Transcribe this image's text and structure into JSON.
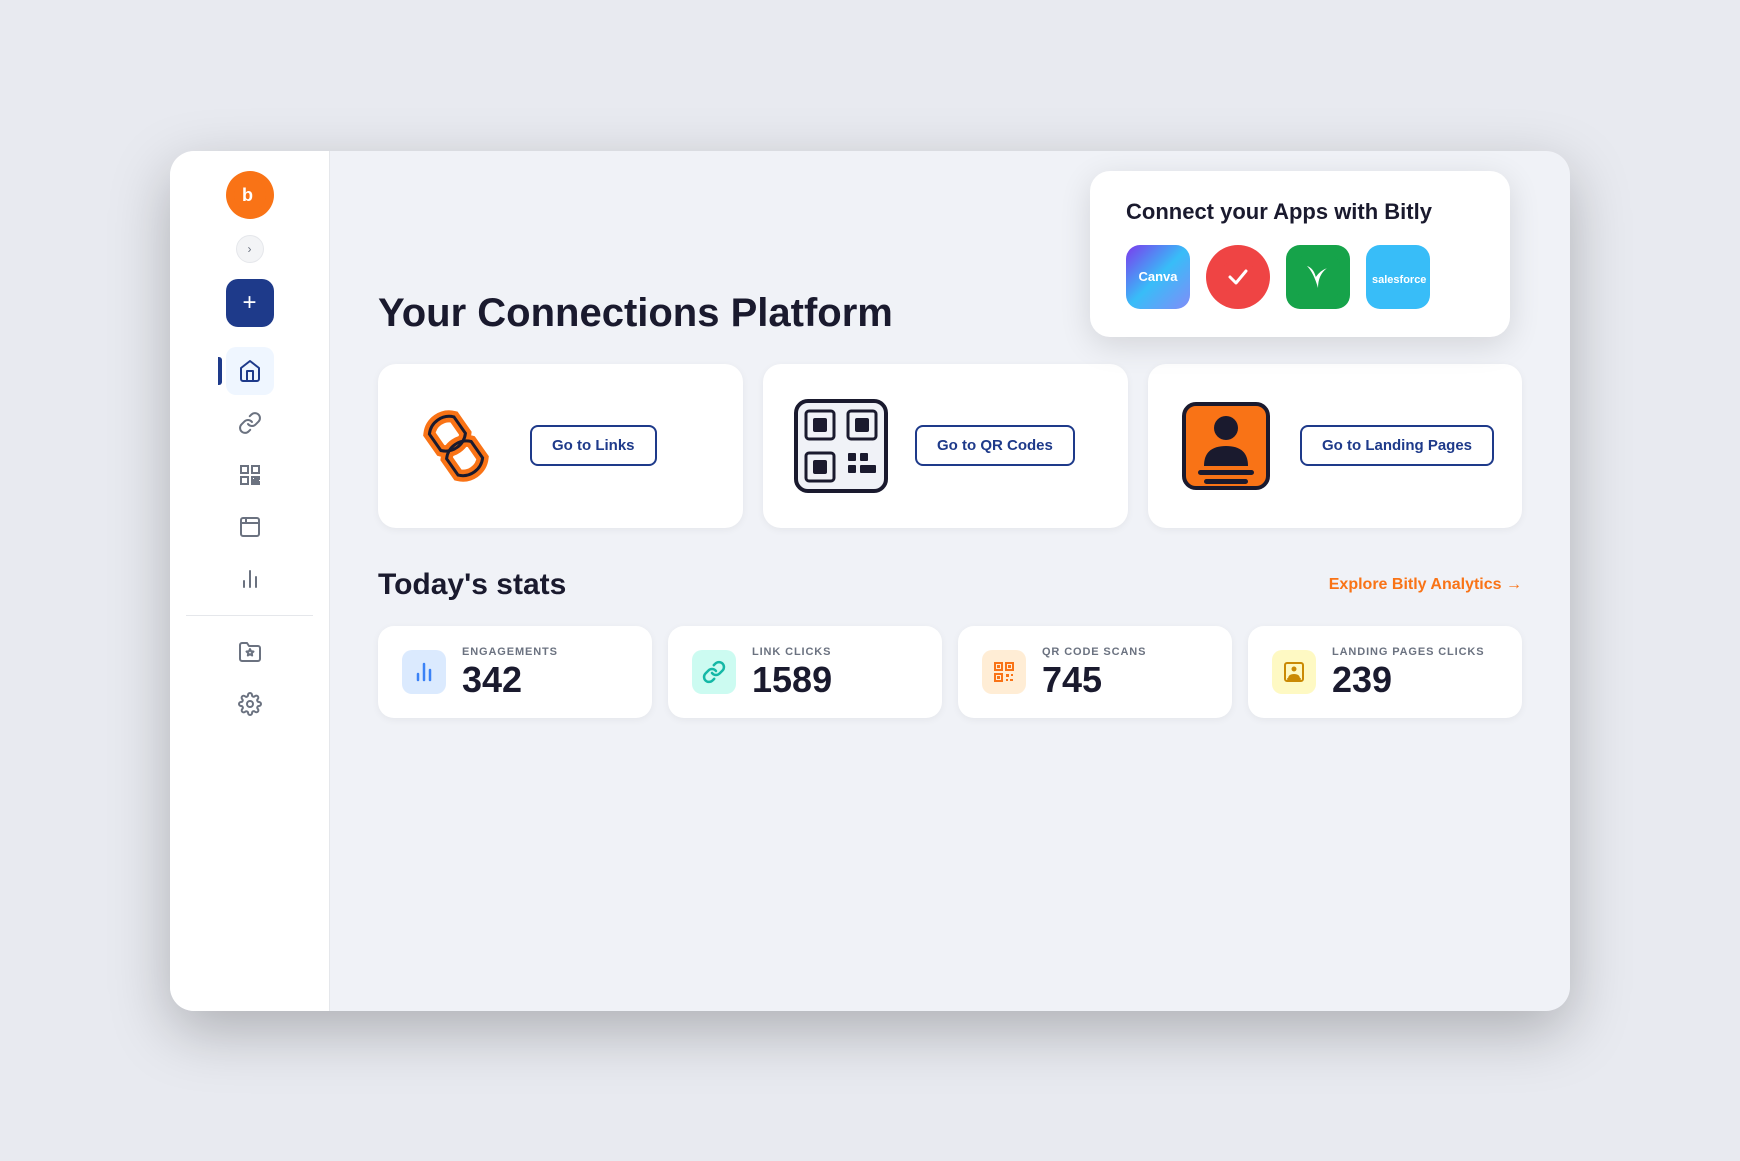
{
  "sidebar": {
    "logo_alt": "Bitly logo",
    "create_label": "+",
    "expand_label": "›",
    "nav_items": [
      {
        "id": "home",
        "label": "Home",
        "active": true
      },
      {
        "id": "links",
        "label": "Links",
        "active": false
      },
      {
        "id": "qr-codes",
        "label": "QR Codes",
        "active": false
      },
      {
        "id": "landing-pages",
        "label": "Landing Pages",
        "active": false
      },
      {
        "id": "analytics",
        "label": "Analytics",
        "active": false
      },
      {
        "id": "starred",
        "label": "Starred",
        "active": false
      },
      {
        "id": "settings",
        "label": "Settings",
        "active": false
      }
    ]
  },
  "popup": {
    "title": "Connect your Apps with Bitly",
    "apps": [
      {
        "id": "canva",
        "label": "Canva"
      },
      {
        "id": "ticktick",
        "label": "TickTick"
      },
      {
        "id": "sprout",
        "label": "Sprout"
      },
      {
        "id": "salesforce",
        "label": "salesforce"
      }
    ]
  },
  "main": {
    "page_title": "Your Connections Platform",
    "nav_cards": [
      {
        "id": "links",
        "button_label": "Go to Links"
      },
      {
        "id": "qr-codes",
        "button_label": "Go to QR Codes"
      },
      {
        "id": "landing-pages",
        "button_label": "Go to Landing Pages"
      }
    ],
    "stats": {
      "title": "Today's stats",
      "explore_link": "Explore Bitly Analytics →",
      "items": [
        {
          "id": "engagements",
          "label": "ENGAGEMENTS",
          "value": "342",
          "icon_type": "blue"
        },
        {
          "id": "link-clicks",
          "label": "LINK CLICKS",
          "value": "1589",
          "icon_type": "teal"
        },
        {
          "id": "qr-scans",
          "label": "QR CODE SCANS",
          "value": "745",
          "icon_type": "orange"
        },
        {
          "id": "lp-clicks",
          "label": "LANDING PAGES CLICKS",
          "value": "239",
          "icon_type": "yellow"
        }
      ]
    }
  },
  "colors": {
    "brand_orange": "#f97316",
    "brand_navy": "#1e3a8a",
    "accent_blue": "#3b82f6"
  }
}
